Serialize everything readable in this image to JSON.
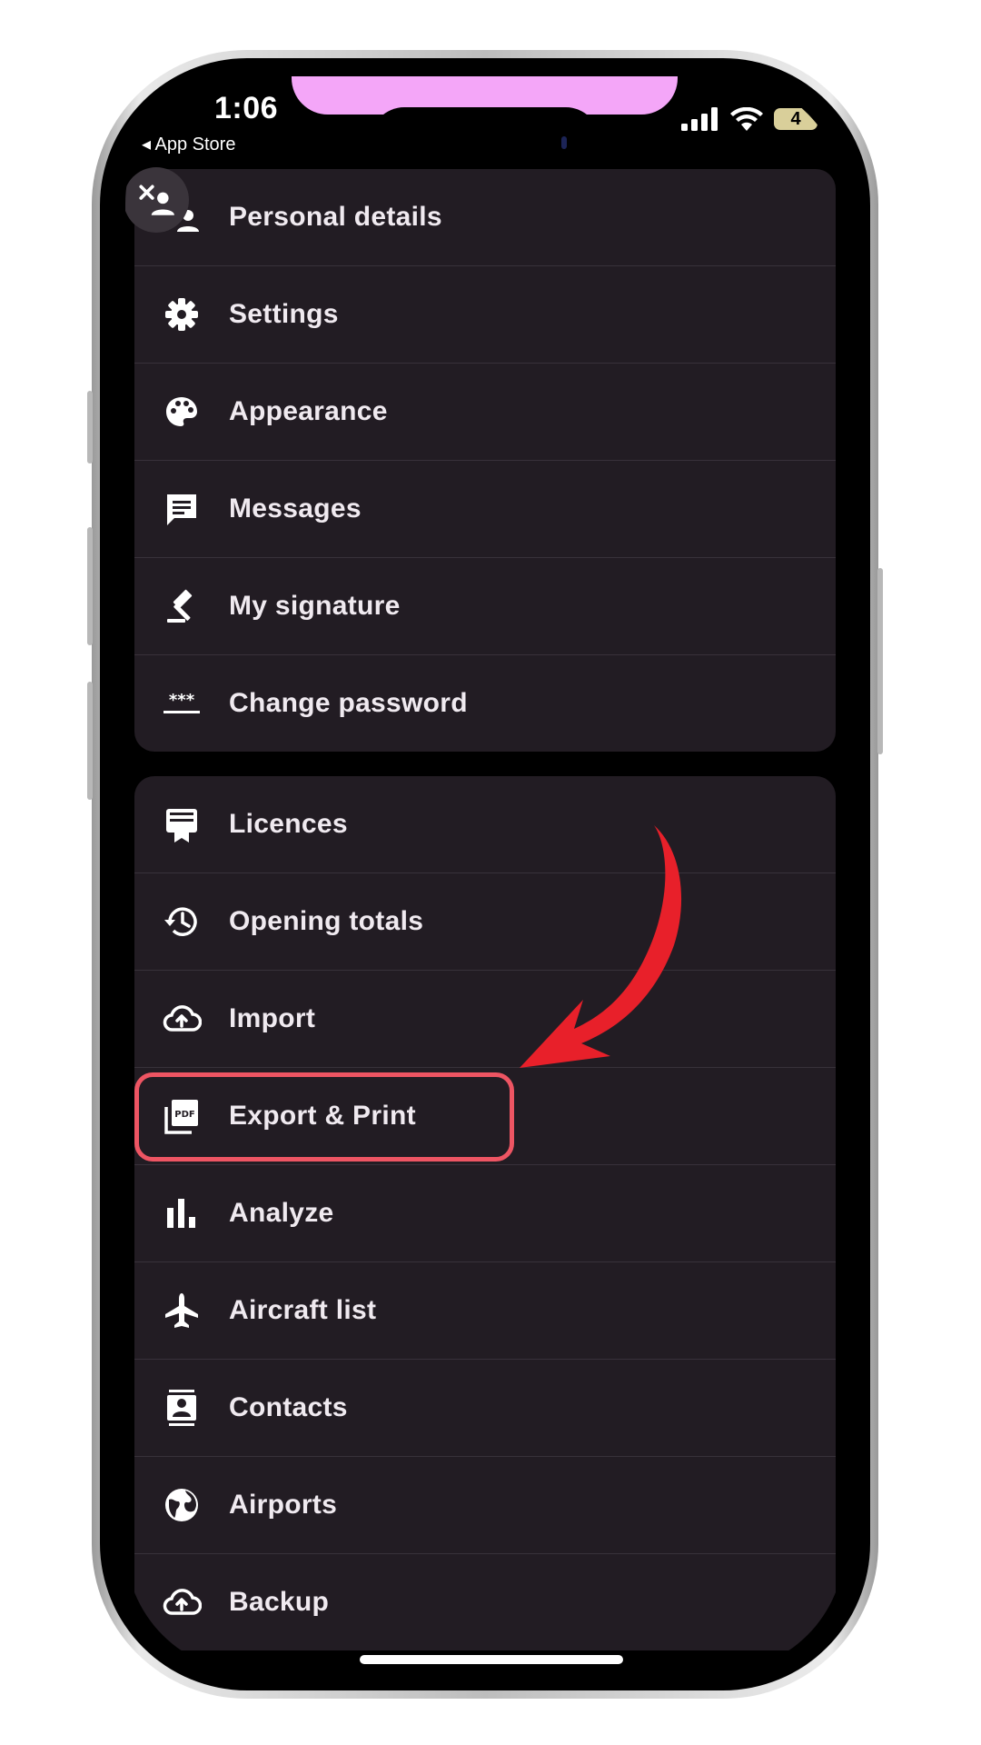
{
  "status_bar": {
    "time": "1:06",
    "back_app": "◂ App Store",
    "battery": "4"
  },
  "menu": {
    "group1": [
      {
        "label": "Personal details",
        "icon": "person-remove-icon"
      },
      {
        "label": "Settings",
        "icon": "gear-icon"
      },
      {
        "label": "Appearance",
        "icon": "palette-icon"
      },
      {
        "label": "Messages",
        "icon": "message-icon"
      },
      {
        "label": "My signature",
        "icon": "gavel-icon"
      },
      {
        "label": "Change password",
        "icon": "password-icon"
      }
    ],
    "group2": [
      {
        "label": "Licences",
        "icon": "licence-icon"
      },
      {
        "label": "Opening totals",
        "icon": "history-icon"
      },
      {
        "label": "Import",
        "icon": "cloud-upload-icon"
      },
      {
        "label": "Export & Print",
        "icon": "pdf-icon"
      },
      {
        "label": "Analyze",
        "icon": "bar-chart-icon"
      },
      {
        "label": "Aircraft list",
        "icon": "airplane-icon"
      },
      {
        "label": "Contacts",
        "icon": "contacts-icon"
      },
      {
        "label": "Airports",
        "icon": "globe-icon"
      },
      {
        "label": "Backup",
        "icon": "cloud-backup-icon"
      }
    ]
  },
  "colors": {
    "background": "#000000",
    "card": "#221c23",
    "highlight": "#ee5563",
    "arrow": "#e8202a",
    "notification_pill": "#f4a6f8"
  }
}
